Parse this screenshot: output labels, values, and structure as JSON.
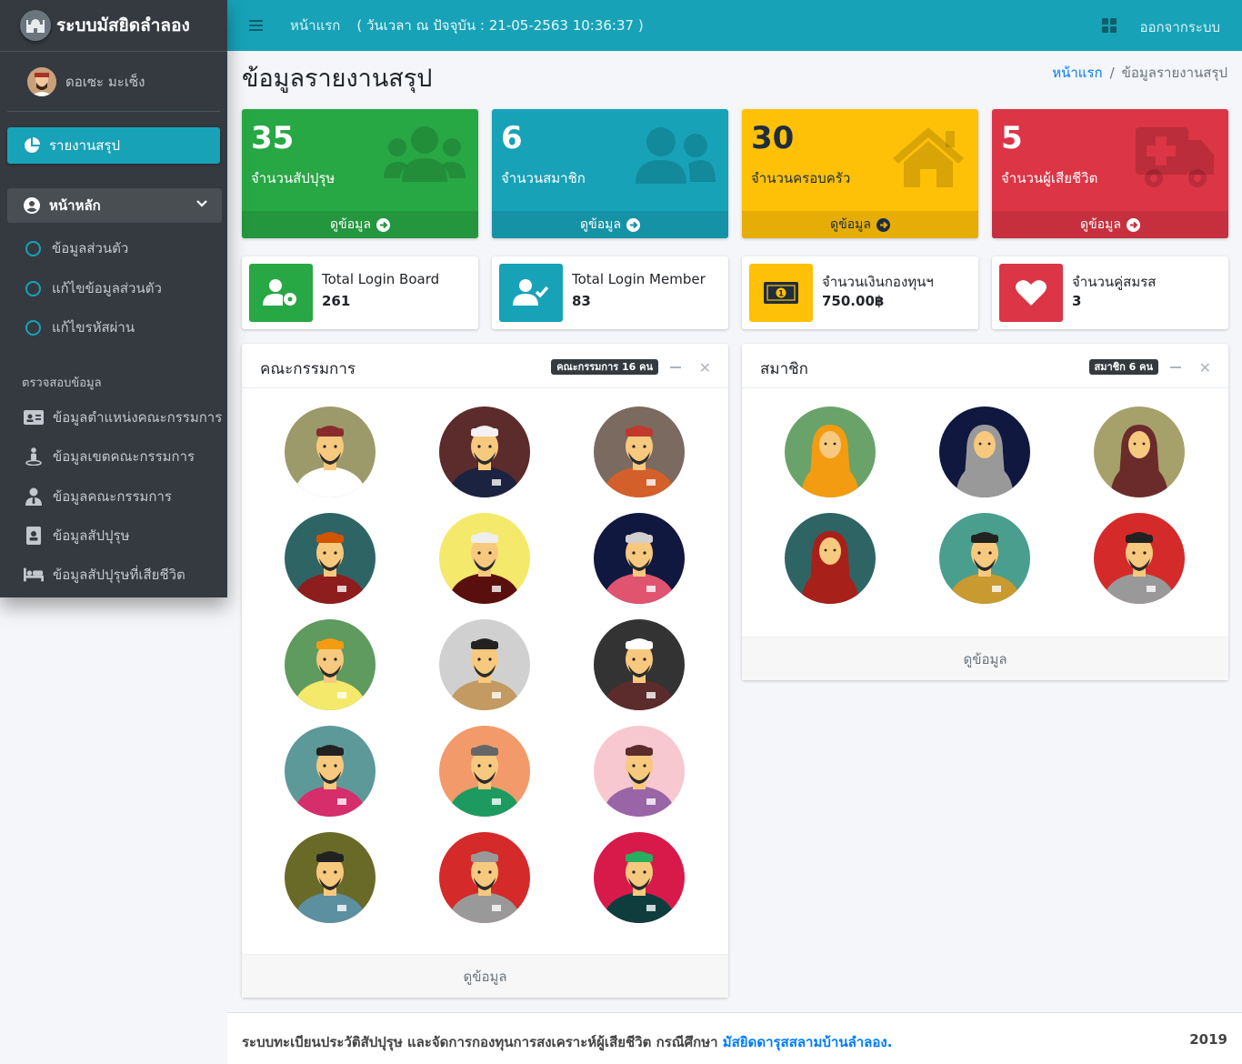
{
  "brand": {
    "name": "ระบบมัสยิดลำลอง"
  },
  "user": {
    "name": "ดอเซะ มะเซ็ง"
  },
  "sidebar": {
    "active_item": "รายงานสรุป",
    "main_menu": "หน้าหลัก",
    "sub_items": [
      "ข้อมูลส่วนตัว",
      "แก้ไขข้อมูลส่วนตัว",
      "แก้ไขรหัสผ่าน"
    ],
    "header": "ตรวจสอบข้อมูล",
    "items": [
      "ข้อมูลตำแหน่งคณะกรรมการ",
      "ข้อมูลเขตคณะกรรมการ",
      "ข้อมูลคณะกรรมการ",
      "ข้อมูลสัปปุรุษ",
      "ข้อมูลสัปปุรุษที่เสียชีวิต"
    ]
  },
  "topbar": {
    "home": "หน้าแรก",
    "clock": "( วันเวลา ณ ปัจจุบัน : 21-05-2563 10:36:37 )",
    "logout": "ออกจากระบบ"
  },
  "page": {
    "title": "ข้อมูลรายงานสรุป"
  },
  "breadcrumb": {
    "home": "หน้าแรก",
    "current": "ข้อมูลรายงานสรุป"
  },
  "stat_boxes": [
    {
      "value": "35",
      "label": "จำนวนสัปปุรุษ",
      "link": "ดูข้อมูล",
      "color": "#28a745",
      "icon": "users-icon"
    },
    {
      "value": "6",
      "label": "จำนวนสมาชิก",
      "link": "ดูข้อมูล",
      "color": "#17a2b8",
      "icon": "user-friends-icon"
    },
    {
      "value": "30",
      "label": "จำนวนครอบครัว",
      "link": "ดูข้อมูล",
      "color": "#ffc107",
      "icon": "home-icon"
    },
    {
      "value": "5",
      "label": "จำนวนผู้เสียชีวิต",
      "link": "ดูข้อมูล",
      "color": "#dc3545",
      "icon": "ambulance-icon"
    }
  ],
  "info_boxes": [
    {
      "title": "Total Login Board",
      "value": "261",
      "color": "#28a745",
      "icon": "user-cog-icon"
    },
    {
      "title": "Total Login Member",
      "value": "83",
      "color": "#17a2b8",
      "icon": "user-check-icon"
    },
    {
      "title": "จำนวนเงินกองทุนฯ",
      "value": "750.00฿",
      "color": "#ffc107",
      "icon": "money-bill-icon"
    },
    {
      "title": "จำนวนคู่สมรส",
      "value": "3",
      "color": "#dc3545",
      "icon": "heart-icon"
    }
  ],
  "committee_card": {
    "title": "คณะกรรมการ",
    "badge": "คณะกรรมการ 16 คน",
    "footer": "ดูข้อมูล"
  },
  "member_card": {
    "title": "สมาชิก",
    "badge": "สมาชิก 6 คน",
    "footer": "ดูข้อมูล"
  },
  "footer": {
    "text": "ระบบทะเบียนประวัติสัปปุรุษ และจัดการกองทุนการสงเคราะห์ผู้เสียชีวิต กรณีศึกษา ",
    "link": "มัสยิดดารุสสลามบ้านลำลอง.",
    "year": "2019"
  }
}
